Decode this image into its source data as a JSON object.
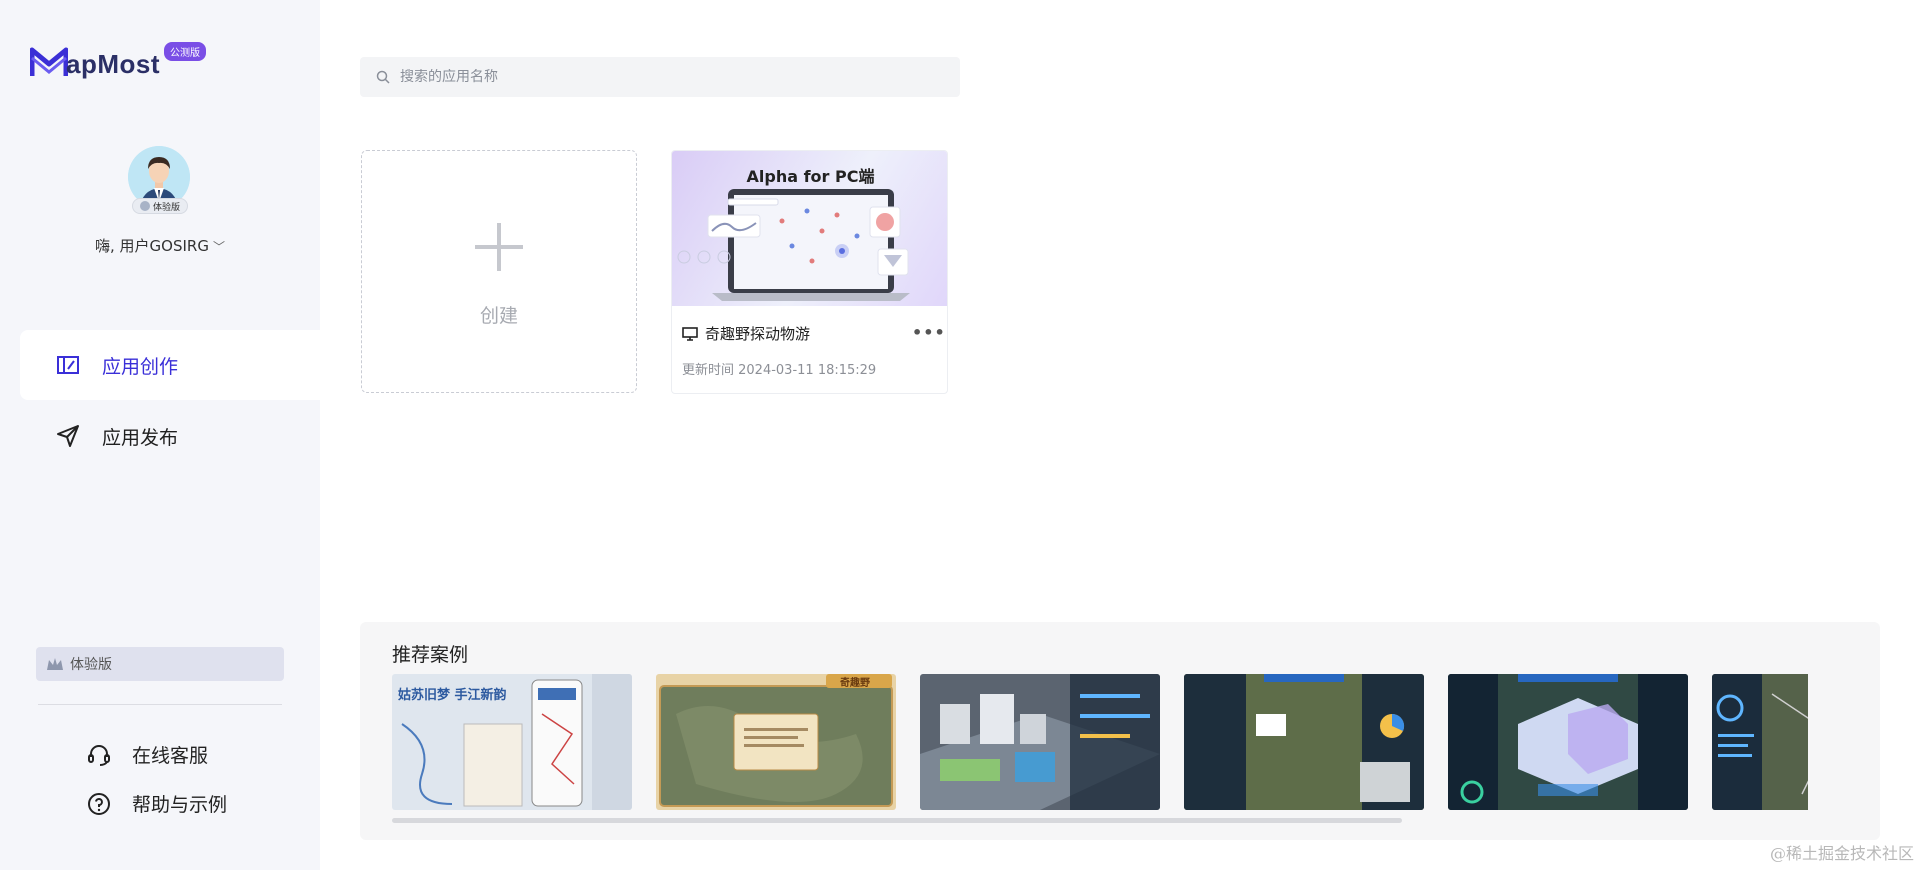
{
  "brand": {
    "logo_text": "apMost",
    "beta_badge": "公测版",
    "logo_color": "#2b2f66",
    "badge_color": "#7a4ee6"
  },
  "user": {
    "avatar_tag": "体验版",
    "greeting": "嗨, 用户GOSIRG",
    "dropdown_icon": "chevron-down-icon"
  },
  "nav": {
    "items": [
      {
        "label": "应用创作",
        "icon": "edit-box-icon",
        "active": true
      },
      {
        "label": "应用发布",
        "icon": "send-icon",
        "active": false
      }
    ],
    "active_color": "#3a2fd8"
  },
  "plan": {
    "label": "体验版"
  },
  "footer": {
    "items": [
      {
        "label": "在线客服",
        "icon": "headset-icon"
      },
      {
        "label": "帮助与示例",
        "icon": "help-circle-icon"
      }
    ]
  },
  "search": {
    "placeholder": "搜索的应用名称",
    "value": ""
  },
  "create_card": {
    "label": "创建"
  },
  "apps": [
    {
      "thumb_title": "Alpha for PC端",
      "name": "奇趣野探动物游",
      "platform_icon": "monitor-icon",
      "updated": "更新时间 2024-03-11 18:15:29"
    }
  ],
  "recommended": {
    "title": "推荐案例",
    "cases": [
      {
        "name": "case-gusu",
        "text": "姑苏旧梦 手江新韵"
      },
      {
        "name": "case-wildlife-map",
        "text": "奇趣野"
      },
      {
        "name": "case-city-3d"
      },
      {
        "name": "case-satellite-dashboard"
      },
      {
        "name": "case-building-bim"
      },
      {
        "name": "case-city-overview"
      }
    ]
  },
  "watermark": "@稀土掘金技术社区"
}
